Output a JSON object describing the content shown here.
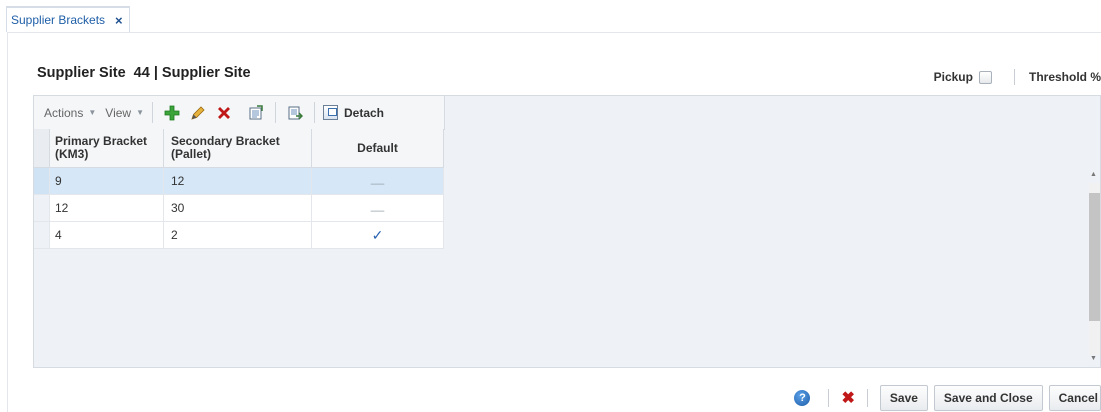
{
  "tab": {
    "label": "Supplier Brackets",
    "close_symbol": "×"
  },
  "header": {
    "title": "Supplier Site  44 | Supplier Site",
    "pickup_label": "Pickup",
    "pickup_checked": false,
    "threshold_label": "Threshold %"
  },
  "toolbar": {
    "actions_label": "Actions",
    "view_label": "View",
    "detach_label": "Detach",
    "icons": [
      "add-icon",
      "edit-icon",
      "delete-icon",
      "export-icon",
      "import-icon"
    ]
  },
  "table": {
    "columns": [
      "Primary Bracket (KM3)",
      "Secondary Bracket (Pallet)",
      "Default"
    ],
    "columns_lines": [
      [
        "Primary Bracket",
        "(KM3)"
      ],
      [
        "Secondary Bracket",
        "(Pallet)"
      ],
      [
        "Default"
      ]
    ],
    "rows": [
      {
        "primary": "9",
        "secondary": "12",
        "default": false,
        "selected": true
      },
      {
        "primary": "12",
        "secondary": "30",
        "default": false,
        "selected": false
      },
      {
        "primary": "4",
        "secondary": "2",
        "default": true,
        "selected": false
      }
    ]
  },
  "footer": {
    "help_symbol": "?",
    "save_label": "Save",
    "save_close_label": "Save and Close",
    "cancel_label": "Cancel"
  },
  "colors": {
    "link": "#1f5fa8",
    "selected_row": "#d6e8f7",
    "delete": "#c01818",
    "add": "#3aa33a"
  }
}
